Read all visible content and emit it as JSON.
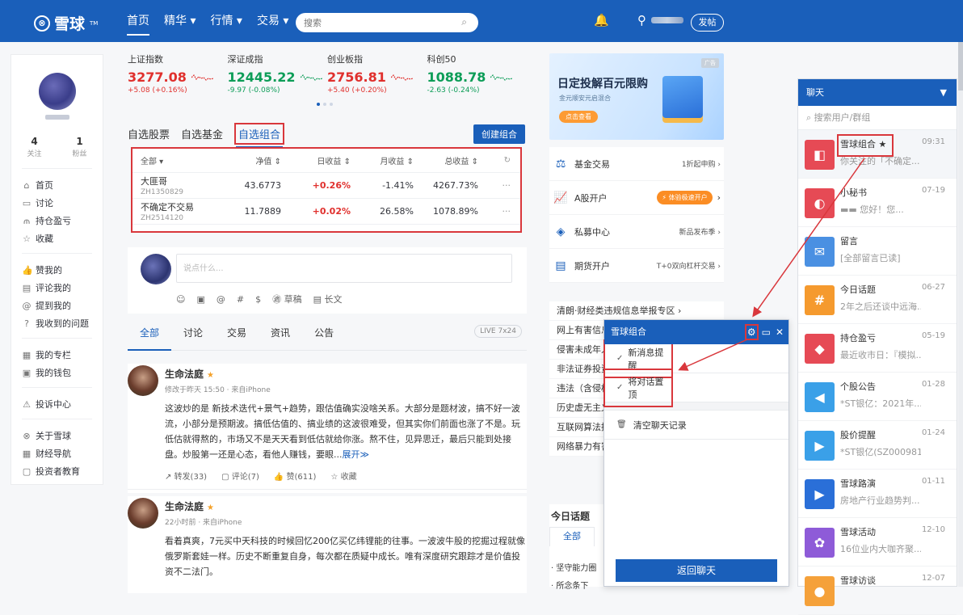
{
  "header": {
    "logo": "雪球",
    "logo_tm": "TM",
    "nav": [
      "首页",
      "精华",
      "行情",
      "交易"
    ],
    "search_placeholder": "搜索",
    "post_button": "发帖"
  },
  "sidebar": {
    "stats": [
      {
        "value": "4",
        "label": "关注"
      },
      {
        "value": "1",
        "label": "粉丝"
      }
    ],
    "groups": [
      [
        {
          "icon": "home-icon",
          "label": "首页"
        },
        {
          "icon": "chat-icon",
          "label": "讨论"
        },
        {
          "icon": "chart-icon",
          "label": "持仓盈亏"
        },
        {
          "icon": "star-icon",
          "label": "收藏"
        }
      ],
      [
        {
          "icon": "thumb-icon",
          "label": "赞我的"
        },
        {
          "icon": "comment-icon",
          "label": "评论我的"
        },
        {
          "icon": "at-icon",
          "label": "提到我的"
        },
        {
          "icon": "question-icon",
          "label": "我收到的问题"
        }
      ],
      [
        {
          "icon": "column-icon",
          "label": "我的专栏"
        },
        {
          "icon": "wallet-icon",
          "label": "我的钱包"
        }
      ],
      [
        {
          "icon": "warning-icon",
          "label": "投诉中心"
        }
      ],
      [
        {
          "icon": "logo-icon",
          "label": "关于雪球"
        },
        {
          "icon": "grid-icon",
          "label": "财经导航"
        },
        {
          "icon": "book-icon",
          "label": "投资者教育"
        }
      ]
    ]
  },
  "indices": [
    {
      "name": "上证指数",
      "value": "3277.08",
      "change": "+5.08 (+0.16%)",
      "color": "#e0302d"
    },
    {
      "name": "深证成指",
      "value": "12445.22",
      "change": "-9.97 (-0.08%)",
      "color": "#0d9d58"
    },
    {
      "name": "创业板指",
      "value": "2756.81",
      "change": "+5.40 (+0.20%)",
      "color": "#e0302d"
    },
    {
      "name": "科创50",
      "value": "1088.78",
      "change": "-2.63 (-0.24%)",
      "color": "#0d9d58"
    }
  ],
  "watch_tabs": [
    "自选股票",
    "自选基金",
    "自选组合"
  ],
  "create_portfolio": "创建组合",
  "portfolio_table": {
    "headers": [
      "全部 ▾",
      "净值 ⇕",
      "日收益 ⇕",
      "月收益 ⇕",
      "总收益 ⇕",
      "↻"
    ],
    "rows": [
      {
        "name": "大匪哥",
        "code": "ZH1350829",
        "nav": "43.6773",
        "day": "+0.26%",
        "month": "-1.41%",
        "total": "4267.73%",
        "more": "···"
      },
      {
        "name": "不确定不交易",
        "code": "ZH2514120",
        "nav": "11.7889",
        "day": "+0.02%",
        "month": "26.58%",
        "total": "1078.89%",
        "more": "···"
      }
    ]
  },
  "compose": {
    "placeholder": "说点什么...",
    "tools": [
      "☺",
      "▣",
      "@",
      "#",
      "$",
      "㊜ 草稿",
      "▤ 长文"
    ]
  },
  "feed_tabs": [
    "全部",
    "讨论",
    "交易",
    "资讯",
    "公告"
  ],
  "live_badge": "LIVE 7x24",
  "posts": [
    {
      "author": "生命法庭",
      "time": "修改于昨天 15:50 · 来自iPhone",
      "text": "这波炒的是 新技术迭代+景气+趋势，跟估值确实没啥关系。大部分是题材波，搞不好一波流，小部分是预期波。搞低估值的、搞业绩的这波很难受，但其实你们前面也涨了不是。玩低估就得熬的，市场又不是天天看到低估就给你涨。熬不住，见异思迁，最后只能到处接盘。炒股第一还是心态，看他人赚钱，要眼...",
      "more": "展开≫",
      "actions": [
        "↗ 转发(33)",
        "▢ 评论(7)",
        "👍 赞(611)",
        "☆ 收藏"
      ]
    },
    {
      "author": "生命法庭",
      "time": "22小时前 · 来自iPhone",
      "text": "看着真爽，7元买中天科技的时候回忆200亿买亿纬锂能的往事。一波波牛股的挖掘过程就像俄罗斯套娃一样。历史不断重复自身，每次都在质疑中成长。唯有深度研究跟踪才是价值投资不二法门。"
    }
  ],
  "banner": {
    "ad": "广告",
    "title": "日定投解百元限购",
    "subtitle": "金元顺安元启混合",
    "button": "点击查看"
  },
  "services": [
    {
      "icon": "scale-icon",
      "name": "基金交易",
      "right": "1折起申购 ›"
    },
    {
      "icon": "line-chart-icon",
      "name": "A股开户",
      "tag": "⚡ 体验极速开户",
      "right": "›"
    },
    {
      "icon": "diamond-icon",
      "name": "私募中心",
      "right": "新品发布季 ›"
    },
    {
      "icon": "document-icon",
      "name": "期货开户",
      "right": "T+0双向杠杆交易 ›"
    }
  ],
  "reports": [
    "清朗·财经类违规信息举报专区    ›",
    "网上有害信息举报",
    "侵害未成年人权益",
    "非法证券投资",
    "违法（含侵权）",
    "历史虚无主义",
    "互联网算法推荐",
    "网络暴力有害"
  ],
  "today": {
    "title": "今日话题",
    "tab": "全部",
    "items": [
      "· 坚守能力圈",
      "· 所念条下",
      "..."
    ]
  },
  "chat": {
    "title": "聊天",
    "search_placeholder": "搜索用户/群组",
    "items": [
      {
        "name": "雪球组合 ★",
        "time": "09:31",
        "msg": "你关注的「不确定...",
        "color": "#e64a55",
        "glyph": "◧"
      },
      {
        "name": "小秘书",
        "time": "07-19",
        "msg": "▬▬ 您好！您...",
        "color": "#e64a55",
        "glyph": "◐"
      },
      {
        "name": "留言",
        "time": "",
        "msg": "[全部留言已读]",
        "color": "#4a90e2",
        "glyph": "✉"
      },
      {
        "name": "今日话题",
        "time": "06-27",
        "msg": "2年之后还谈中远海...",
        "color": "#f59a2e",
        "glyph": "#"
      },
      {
        "name": "持仓盈亏",
        "time": "05-19",
        "msg": "最近收市日：『模拟...",
        "color": "#e64a55",
        "glyph": "◆"
      },
      {
        "name": "个股公告",
        "time": "01-28",
        "msg": "*ST银亿：2021年...",
        "color": "#3aa0e8",
        "glyph": "◀"
      },
      {
        "name": "股价提醒",
        "time": "01-24",
        "msg": "*ST银亿(SZ000981...",
        "color": "#3aa0e8",
        "glyph": "▶"
      },
      {
        "name": "雪球路演",
        "time": "01-11",
        "msg": "房地产行业趋势判...",
        "color": "#2a6fd8",
        "glyph": "▶"
      },
      {
        "name": "雪球活动",
        "time": "12-10",
        "msg": "16位业内大咖齐聚...",
        "color": "#8e5bd8",
        "glyph": "✿"
      },
      {
        "name": "雪球访谈",
        "time": "12-07",
        "msg": "",
        "color": "#f5a13a",
        "glyph": "●"
      }
    ]
  },
  "popup": {
    "title": "雪球组合",
    "options": [
      "新消息提醒",
      "将对话置顶"
    ],
    "clear": "清空聊天记录",
    "back": "返回聊天"
  }
}
